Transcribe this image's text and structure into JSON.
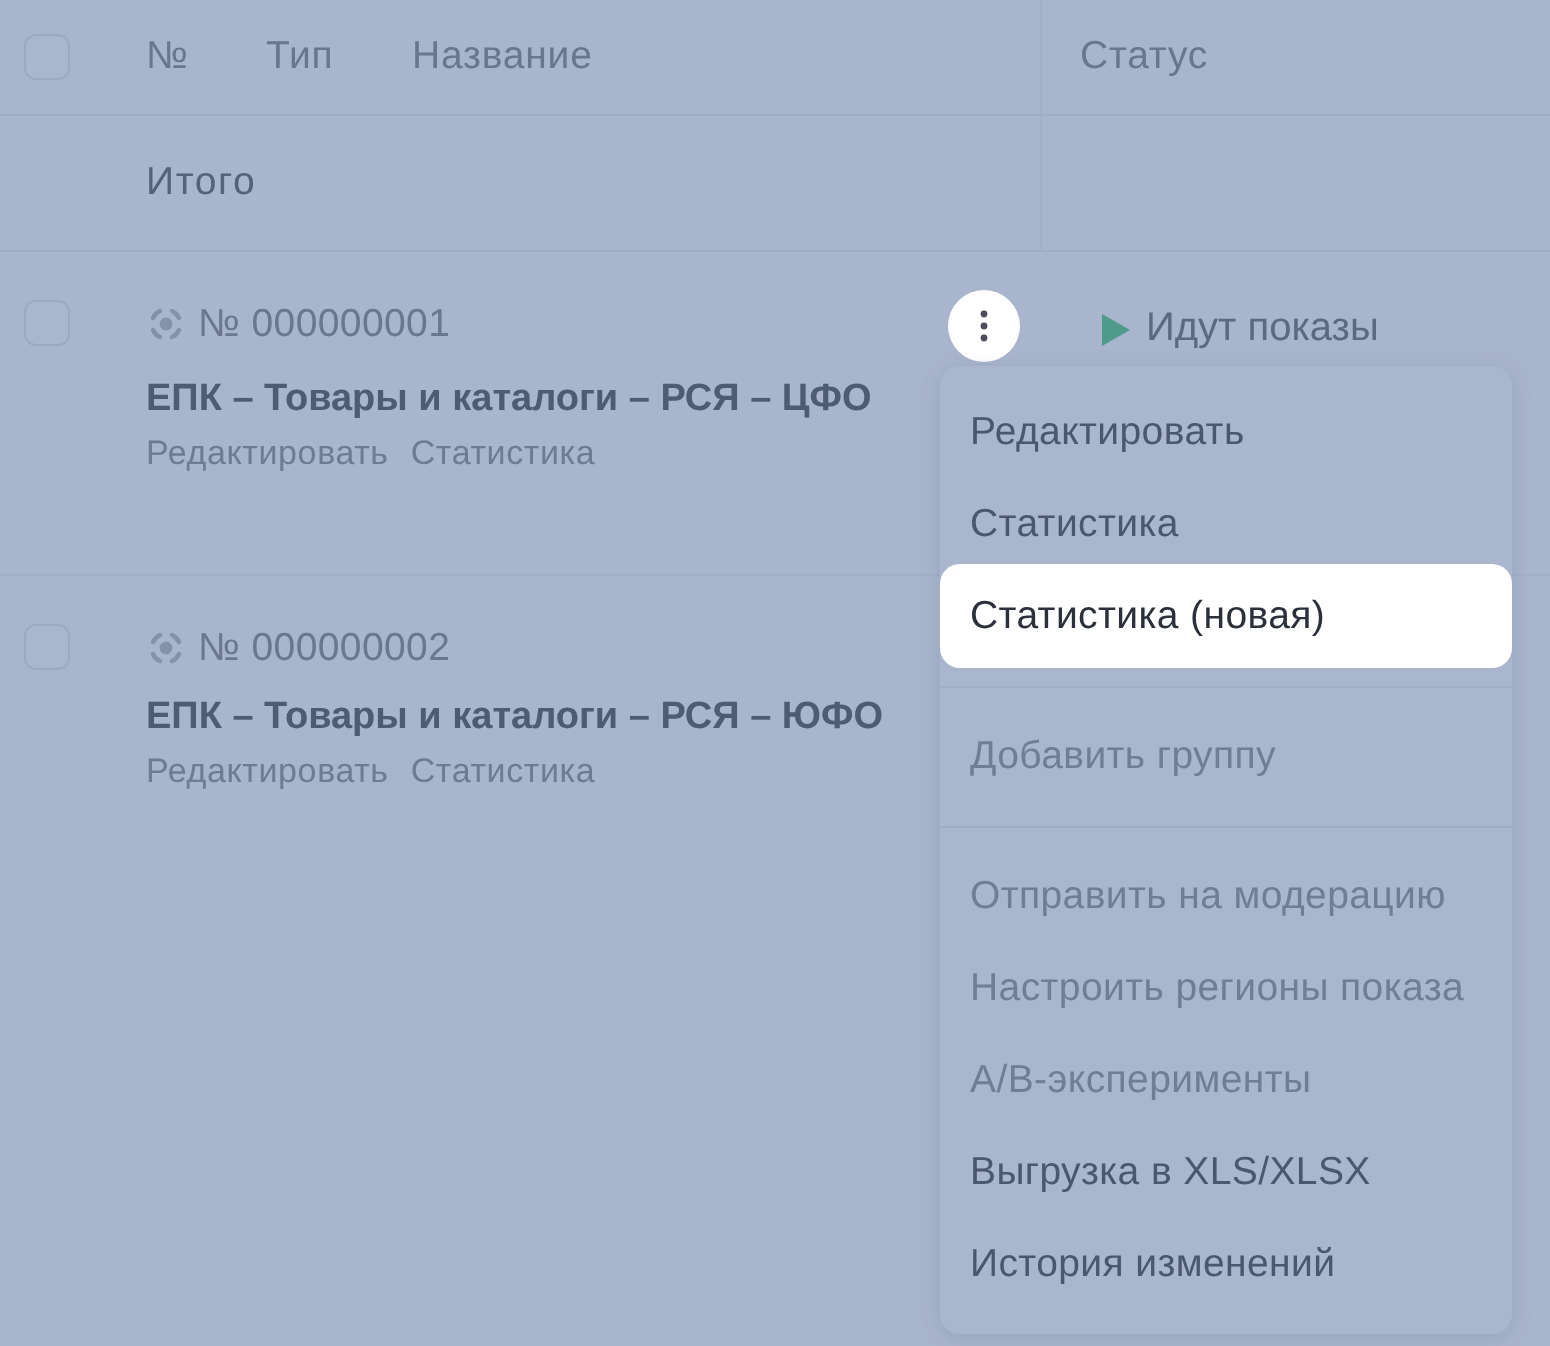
{
  "table": {
    "select_all": {
      "checked": false
    },
    "columns": [
      "№",
      "Тип",
      "Название",
      "Статус"
    ],
    "total_row": {
      "label": "Итого"
    },
    "rows": [
      {
        "checked": false,
        "number": "№ 000000001",
        "title": "ЕПК – Товары и каталоги – РСЯ – ЦФО",
        "actions": [
          "Редактировать",
          "Статистика"
        ],
        "status": {
          "label": "Идут показы",
          "kind": "active"
        },
        "more_button": {
          "open": true
        }
      },
      {
        "checked": false,
        "number": "№ 000000002",
        "title": "ЕПК – Товары и каталоги – РСЯ – ЮФО",
        "actions": [
          "Редактировать",
          "Статистика"
        ]
      }
    ]
  },
  "context_menu": {
    "sections": [
      {
        "items": [
          {
            "label": "Редактировать",
            "disabled": false,
            "selected": false
          },
          {
            "label": "Статистика",
            "disabled": false,
            "selected": false
          },
          {
            "label": "Статистика (новая)",
            "disabled": false,
            "selected": true
          }
        ]
      },
      {
        "items": [
          {
            "label": "Добавить группу",
            "disabled": true,
            "selected": false
          }
        ]
      },
      {
        "items": [
          {
            "label": "Отправить на модерацию",
            "disabled": true,
            "selected": false
          },
          {
            "label": "Настроить регионы показа",
            "disabled": true,
            "selected": false
          },
          {
            "label": "А/B-эксперименты",
            "disabled": true,
            "selected": false
          },
          {
            "label": "Выгрузка в XLS/XLSX",
            "disabled": false,
            "selected": false
          },
          {
            "label": "История изменений",
            "disabled": false,
            "selected": false
          }
        ]
      }
    ]
  }
}
